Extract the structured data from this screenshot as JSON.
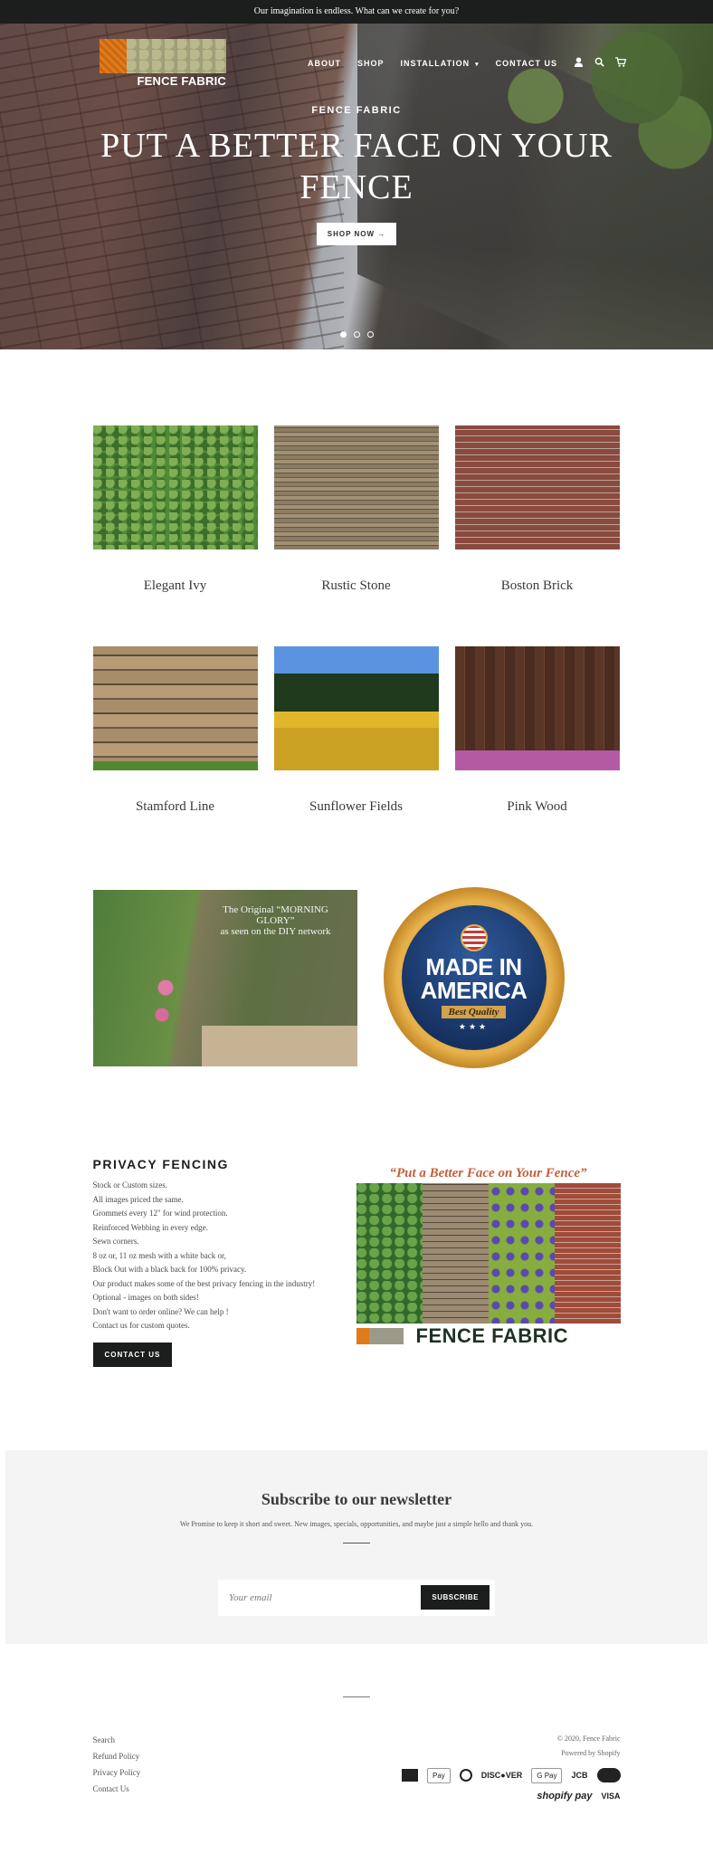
{
  "announcement": "Our imagination is endless. What can we create for you?",
  "brand": {
    "name": "FENCE FABRIC"
  },
  "nav": {
    "items": [
      "ABOUT",
      "SHOP",
      "INSTALLATION",
      "CONTACT US"
    ],
    "installation_caret": "▾",
    "icons": {
      "account": "👤",
      "search": "🔍",
      "cart": "🛒"
    }
  },
  "hero": {
    "kicker": "FENCE FABRIC",
    "title": "PUT A BETTER FACE ON YOUR FENCE",
    "button": "SHOP NOW →",
    "slides": 3,
    "active_slide": 1
  },
  "collections": [
    {
      "name": "Elegant Ivy"
    },
    {
      "name": "Rustic Stone"
    },
    {
      "name": "Boston Brick"
    },
    {
      "name": "Stamford Line"
    },
    {
      "name": "Sunflower Fields"
    },
    {
      "name": "Pink Wood"
    }
  ],
  "features": {
    "morning_glory": {
      "line1": "The Original “MORNING",
      "line2": "GLORY”",
      "line3": "as seen on the DIY network"
    },
    "badge": {
      "line1": "MADE IN",
      "line2": "AMERICA",
      "ribbon": "Best Quality",
      "stars": "★★★"
    }
  },
  "privacy": {
    "title": "PRIVACY FENCING",
    "lines": [
      "Stock or Custom sizes.",
      "All images priced the same.",
      "Grommets every 12\" for wind protection.",
      "Reinforced Webbing in every edge.",
      "Sewn corners.",
      "8 oz or, 11 oz mesh with a white back or,",
      "Block Out with a black back for 100% privacy.",
      "Our product makes some of the best privacy fencing in the industry!",
      "Optional - images on both sides!",
      "Don't want to order online? We can help !",
      "Contact us for custom quotes."
    ],
    "button": "CONTACT US",
    "promo_quote": "“Put a Better Face on Your Fence”",
    "promo_brand": "FENCE FABRIC"
  },
  "newsletter": {
    "title": "Subscribe to our newsletter",
    "subtitle": "We Promise to keep it short and sweet. New images, specials, opportunities, and maybe just a simple hello and thank you.",
    "placeholder": "Your email",
    "button": "SUBSCRIBE"
  },
  "footer": {
    "links": [
      "Search",
      "Refund Policy",
      "Privacy Policy",
      "Contact Us"
    ],
    "copyright": "© 2020, Fence Fabric",
    "powered": "Powered by Shopify",
    "payments": [
      "American Express",
      "Apple Pay",
      "Diners Club",
      "DISCOVER",
      "G Pay",
      "JCB",
      "Mastercard",
      "shopify pay",
      "VISA"
    ],
    "payment_labels": {
      "apple": " Pay",
      "discover": "DISC●VER",
      "gpay": "G Pay",
      "jcb": "JCB",
      "shopify": "shopify pay",
      "visa": "VISA"
    }
  }
}
